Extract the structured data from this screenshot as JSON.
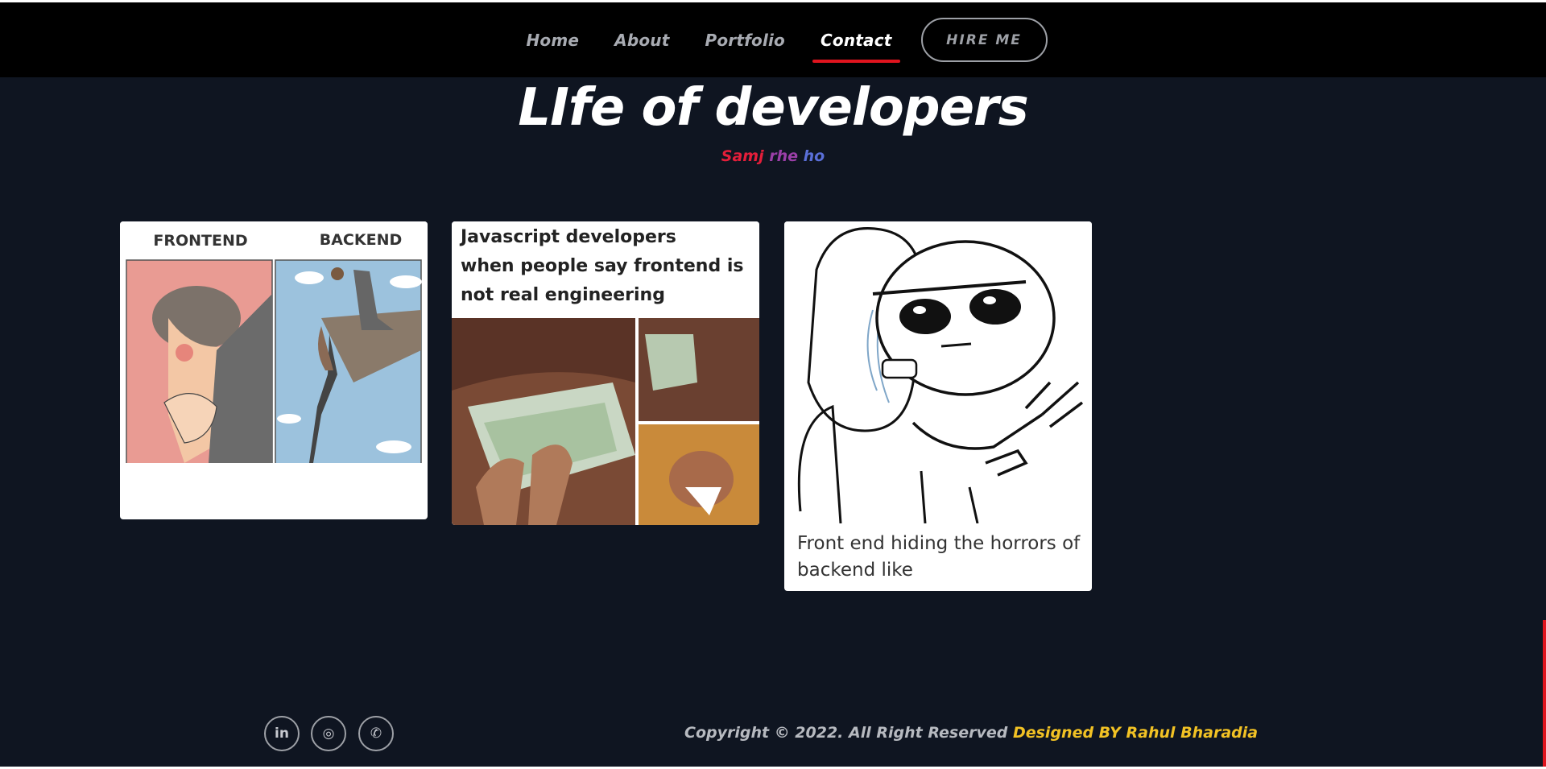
{
  "nav": {
    "links": [
      "Home",
      "About",
      "Portfolio",
      "Contact"
    ],
    "active": "Contact",
    "hire_label": "HIRE ME"
  },
  "hero": {
    "title": "LIfe of developers",
    "subtitle_words": [
      "Samj",
      "rhe",
      "ho"
    ]
  },
  "cards": [
    {
      "meme_labels": [
        "FRONTEND",
        "BACKEND"
      ],
      "caption": ""
    },
    {
      "meme_text": "Javascript developers when people say frontend is not real engineering",
      "meme_lines": [
        "Javascript developers",
        "when people say frontend is",
        "not real engineering"
      ],
      "caption": ""
    },
    {
      "caption": "Front end hiding the horrors of backend like",
      "caption_lines": [
        "Front end hiding the horrors of",
        "backend like"
      ]
    }
  ],
  "footer": {
    "copyright": "Copyright © 2022. All Right Reserved",
    "designer": "Designed BY Rahul Bharadia",
    "social": [
      {
        "icon": "linkedin-icon",
        "glyph": "in"
      },
      {
        "icon": "instagram-icon",
        "glyph": "◎"
      },
      {
        "icon": "whatsapp-icon",
        "glyph": "✆"
      }
    ]
  },
  "colors": {
    "background": "#0f1521",
    "nav_bg": "#000000",
    "accent_red": "#e0141e",
    "designer_gold": "#f2c224"
  }
}
